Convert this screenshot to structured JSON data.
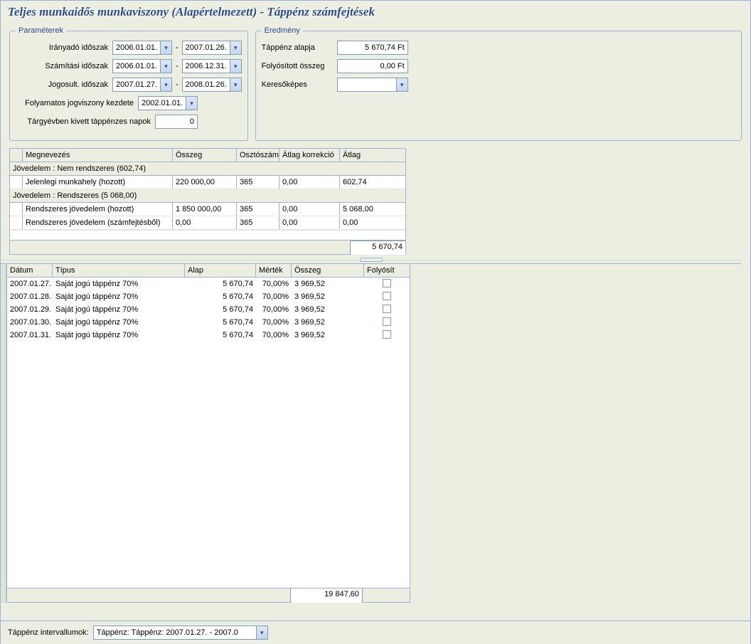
{
  "title": "Teljes munkaidős munkaviszony (Alapértelmezett) - Táppénz számfejtések",
  "params": {
    "legend": "Paraméterek",
    "iranyado_label": "Irányadó időszak",
    "iranyado_from": "2006.01.01.",
    "iranyado_to": "2007.01.26.",
    "szamitasi_label": "Számítási időszak",
    "szamitasi_from": "2006.01.01.",
    "szamitasi_to": "2006.12.31.",
    "jogosult_label": "Jogosult. időszak",
    "jogosult_from": "2007.01.27.",
    "jogosult_to": "2008.01.26.",
    "folyamatos_label": "Folyamatos jogviszony kezdete",
    "folyamatos_val": "2002.01.01.",
    "targyev_label": "Tárgyévben kivett táppénzes napok",
    "targyev_val": "0"
  },
  "results": {
    "legend": "Eredmény",
    "alap_label": "Táppénz alapja",
    "alap_val": "5 670,74 Ft",
    "folyositott_label": "Folyósított összeg",
    "folyositott_val": "0,00 Ft",
    "keresokepes_label": "Keresőképes",
    "keresokepes_val": ""
  },
  "grid1": {
    "headers": {
      "megnevezes": "Megnevezés",
      "osszeg": "Összeg",
      "osztoszam": "Osztószám",
      "atlag_korr": "Átlag korrekció",
      "atlag": "Átlag"
    },
    "group1": "Jövedelem : Nem rendszeres (602,74)",
    "rows1": [
      {
        "name": "Jelenlegi munkahely (hozott)",
        "osszeg": "220 000,00",
        "oszto": "365",
        "korr": "0,00",
        "atlag": "602,74"
      }
    ],
    "group2": "Jövedelem : Rendszeres (5 068,00)",
    "rows2": [
      {
        "name": "Rendszeres jövedelem (hozott)",
        "osszeg": "1 850 000,00",
        "oszto": "365",
        "korr": "0,00",
        "atlag": "5 068,00"
      },
      {
        "name": "Rendszeres jövedelem (számfejtésből)",
        "osszeg": "0,00",
        "oszto": "365",
        "korr": "0,00",
        "atlag": "0,00"
      }
    ],
    "total": "5 670,74"
  },
  "grid2": {
    "headers": {
      "datum": "Dátum",
      "tipus": "Típus",
      "alap": "Alap",
      "mertek": "Mérték",
      "osszeg": "Összeg",
      "folyosit": "Folyósít"
    },
    "rows": [
      {
        "date": "2007.01.27.",
        "type": "Saját jogú táppénz 70%",
        "alap": "5 670,74",
        "mertek": "70,00%",
        "osszeg": "3 969,52"
      },
      {
        "date": "2007.01.28.",
        "type": "Saját jogú táppénz 70%",
        "alap": "5 670,74",
        "mertek": "70,00%",
        "osszeg": "3 969,52"
      },
      {
        "date": "2007.01.29.",
        "type": "Saját jogú táppénz 70%",
        "alap": "5 670,74",
        "mertek": "70,00%",
        "osszeg": "3 969,52"
      },
      {
        "date": "2007.01.30.",
        "type": "Saját jogú táppénz 70%",
        "alap": "5 670,74",
        "mertek": "70,00%",
        "osszeg": "3 969,52"
      },
      {
        "date": "2007.01.31.",
        "type": "Saját jogú táppénz 70%",
        "alap": "5 670,74",
        "mertek": "70,00%",
        "osszeg": "3 969,52"
      }
    ],
    "total": "19 847,60"
  },
  "bottom": {
    "label": "Táppénz intervallumok:",
    "value": "Táppénz: Táppénz: 2007.01.27. - 2007.0"
  }
}
